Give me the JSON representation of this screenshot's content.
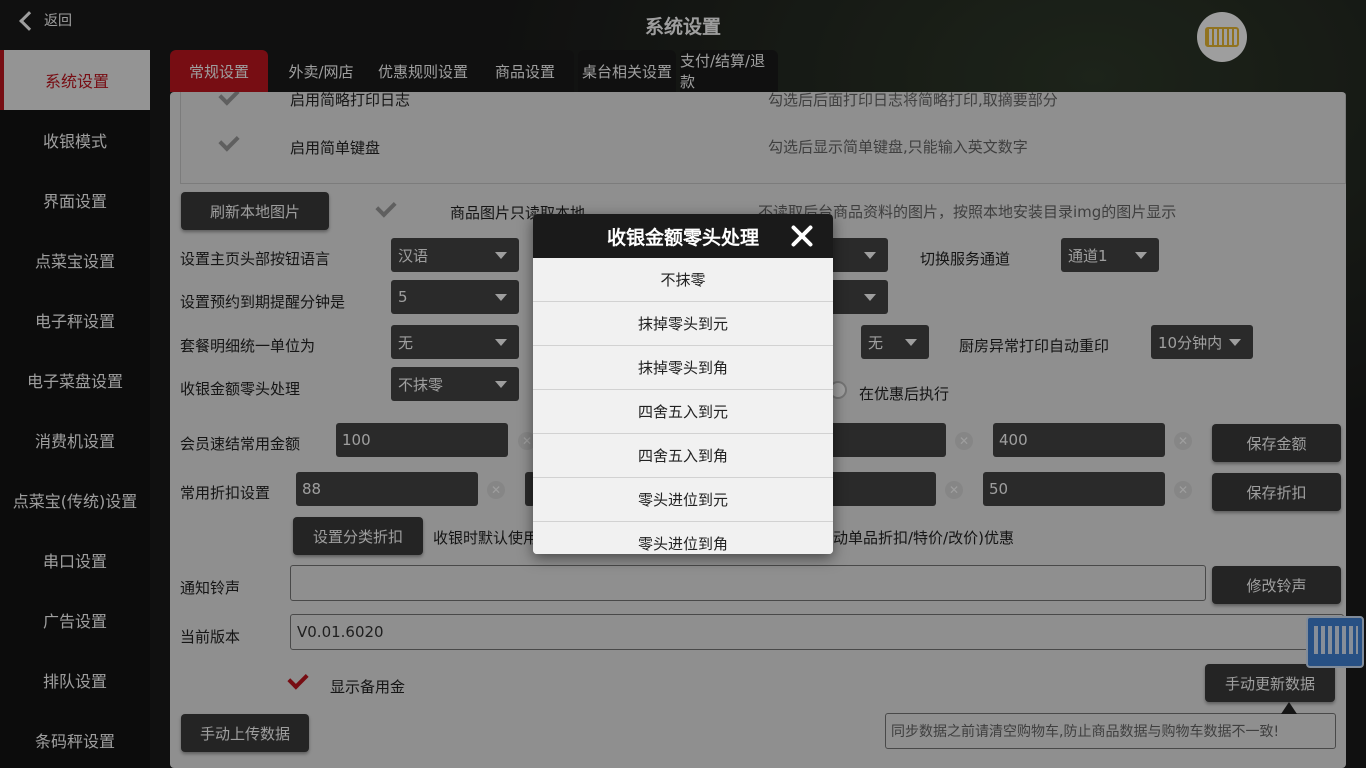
{
  "header": {
    "back_label": "返回",
    "title": "系统设置"
  },
  "sidebar": {
    "items": [
      {
        "label": "系统设置"
      },
      {
        "label": "收银模式"
      },
      {
        "label": "界面设置"
      },
      {
        "label": "点菜宝设置"
      },
      {
        "label": "电子秤设置"
      },
      {
        "label": "电子菜盘设置"
      },
      {
        "label": "消费机设置"
      },
      {
        "label": "点菜宝(传统)设置"
      },
      {
        "label": "串口设置"
      },
      {
        "label": "广告设置"
      },
      {
        "label": "排队设置"
      },
      {
        "label": "条码秤设置"
      }
    ]
  },
  "tabs": [
    {
      "label": "常规设置"
    },
    {
      "label": "外卖/网店"
    },
    {
      "label": "优惠规则设置"
    },
    {
      "label": "商品设置"
    },
    {
      "label": "桌台相关设置"
    },
    {
      "label": "支付/结算/退款"
    }
  ],
  "settings": {
    "simple_print_log": "启用简略打印日志",
    "simple_print_log_desc": "勾选后后面打印日志将简略打印,取摘要部分",
    "simple_keyboard": "启用简单键盘",
    "simple_keyboard_desc": "勾选后显示简单键盘,只能输入英文数字",
    "refresh_images": "刷新本地图片",
    "local_images_only": "商品图片只读取本地",
    "local_images_desc": "不读取后台商品资料的图片，按照本地安装目录img的图片显示",
    "header_language_label": "设置主页头部按钮语言",
    "header_language_value": "汉语",
    "switch_channel_label": "切换服务通道",
    "switch_channel_value": "通道1",
    "reminder_label": "设置预约到期提醒分钟是",
    "reminder_value": "5",
    "combo_unit_label": "套餐明细统一单位为",
    "combo_unit_value": "无",
    "combo_extra_value": "无",
    "kitchen_reprint_label": "厨房异常打印自动重印",
    "kitchen_reprint_value": "10分钟内",
    "rounding_label": "收银金额零头处理",
    "rounding_value": "不抹零",
    "after_discount": "在优惠后执行",
    "member_amount_label": "会员速结常用金额",
    "member_amount_1": "100",
    "member_amount_4": "400",
    "save_amount": "保存金额",
    "discount_label": "常用折扣设置",
    "discount_1": "88",
    "discount_4": "50",
    "save_discount": "保存折扣",
    "category_discount": "设置分类折扣",
    "default_discount_text_a": "收银时默认使用",
    "default_discount_text_b": "动单品折扣/特价/改价)优惠",
    "ringtone_label": "通知铃声",
    "ringtone_value": "",
    "change_ringtone": "修改铃声",
    "version_label": "当前版本",
    "version_value": "V0.01.6020",
    "show_reserve": "显示备用金",
    "manual_update": "手动更新数据",
    "manual_upload": "手动上传数据",
    "sync_note": "同步数据之前请清空购物车,防止商品数据与购物车数据不一致!"
  },
  "modal": {
    "title": "收银金额零头处理",
    "options": [
      "不抹零",
      "抹掉零头到元",
      "抹掉零头到角",
      "四舍五入到元",
      "四舍五入到角",
      "零头进位到元",
      "零头进位到角"
    ]
  },
  "colors": {
    "accent": "#c0151f",
    "dark": "#1a1a1a",
    "panel": "#e7e7e7"
  }
}
